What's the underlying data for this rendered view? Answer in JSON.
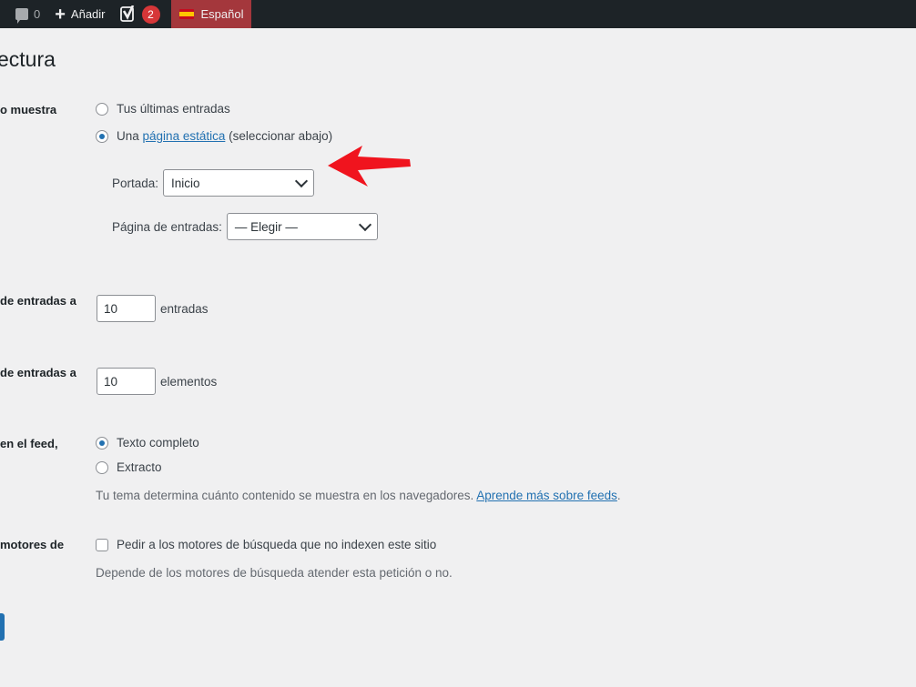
{
  "adminbar": {
    "comments_count": "0",
    "add_label": "Añadir",
    "yoast_count": "2",
    "language_label": "Español"
  },
  "page": {
    "title": "ectura"
  },
  "labels": {
    "homepage_displays": "o muestra",
    "blog_pages_show": "de entradas a",
    "syndication_feeds_show": "de entradas a",
    "feed_include": "en el feed,",
    "search_visibility": "motores de"
  },
  "homepage": {
    "option_latest": "Tus últimas entradas",
    "option_static_prefix": "Una",
    "option_static_link": "página estática",
    "option_static_suffix": "(seleccionar abajo)",
    "front_label": "Portada:",
    "front_value": "Inicio",
    "posts_label": "Página de entradas:",
    "posts_value": "— Elegir —"
  },
  "posts_per_page": {
    "value": "10",
    "unit": "entradas"
  },
  "feed_items": {
    "value": "10",
    "unit": "elementos"
  },
  "feed_content": {
    "option_full": "Texto completo",
    "option_excerpt": "Extracto",
    "description_text": "Tu tema determina cuánto contenido se muestra en los navegadores.",
    "description_link": "Aprende más sobre feeds",
    "description_end": "."
  },
  "visibility": {
    "checkbox_label": "Pedir a los motores de búsqueda que no indexen este sitio",
    "description": "Depende de los motores de búsqueda atender esta petición o no."
  },
  "colors": {
    "adminbar": "#1d2327",
    "accent": "#2271b1",
    "language": "#a4373c",
    "badge": "#d63638",
    "arrow": "#f0141e"
  }
}
